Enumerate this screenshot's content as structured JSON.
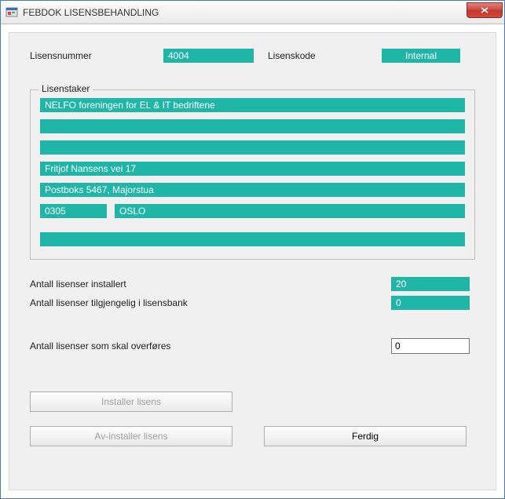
{
  "window": {
    "title": "FEBDOK LISENSBEHANDLING"
  },
  "top": {
    "lisensnummer_label": "Lisensnummer",
    "lisensnummer_value": "4004",
    "lisenskode_label": "Lisenskode",
    "lisenskode_value": "Internal"
  },
  "lisenstaker": {
    "legend": "Lisenstaker",
    "line1": "NELFO foreningen for EL & IT bedriftene",
    "line2": "",
    "line3": "",
    "line4": "Fritjof Nansens vei 17",
    "line5": "Postboks 5467, Majorstua",
    "zip": "0305",
    "city": "OSLO",
    "line7": ""
  },
  "stats": {
    "installert_label": "Antall lisenser installert",
    "installert_value": "20",
    "tilgjengelig_label": "Antall lisenser tilgjengelig i lisensbank",
    "tilgjengelig_value": "0"
  },
  "transfer": {
    "label": "Antall lisenser som skal overføres",
    "value": "0"
  },
  "buttons": {
    "installer": "Installer lisens",
    "avinstaller": "Av-installer lisens",
    "ferdig": "Ferdig"
  }
}
